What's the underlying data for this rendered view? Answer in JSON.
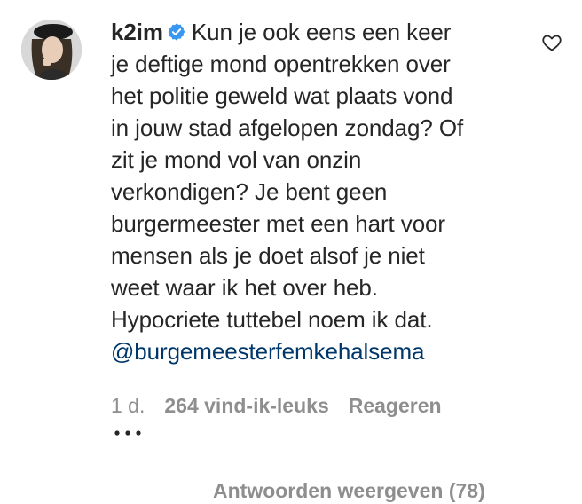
{
  "comment": {
    "username": "k2im",
    "verified_icon": "verified-badge-icon",
    "text_lines": [
      "Kun je ook eens een keer",
      "je deftige mond opentrekken over",
      "het politie geweld wat plaats vond",
      "in jouw stad afgelopen zondag? Of",
      "zit je mond vol van onzin",
      "verkondigen? Je bent geen",
      "burgermeester met een hart voor",
      "mensen als je doet alsof je niet",
      "weet waar ik het over heb.",
      "Hypocriete tuttebel noem ik dat."
    ],
    "mention": "@burgemeesterfemkehalsema",
    "like_icon": "heart-outline-icon"
  },
  "meta": {
    "time": "1 d.",
    "likes": "264 vind-ik-leuks",
    "reply": "Reageren",
    "more_icon": "more-dots-icon"
  },
  "replies": {
    "label": "Antwoorden weergeven (78)"
  },
  "colors": {
    "text": "#262626",
    "secondary": "#8e8e8e",
    "link": "#00376b",
    "verified": "#3897f0"
  }
}
